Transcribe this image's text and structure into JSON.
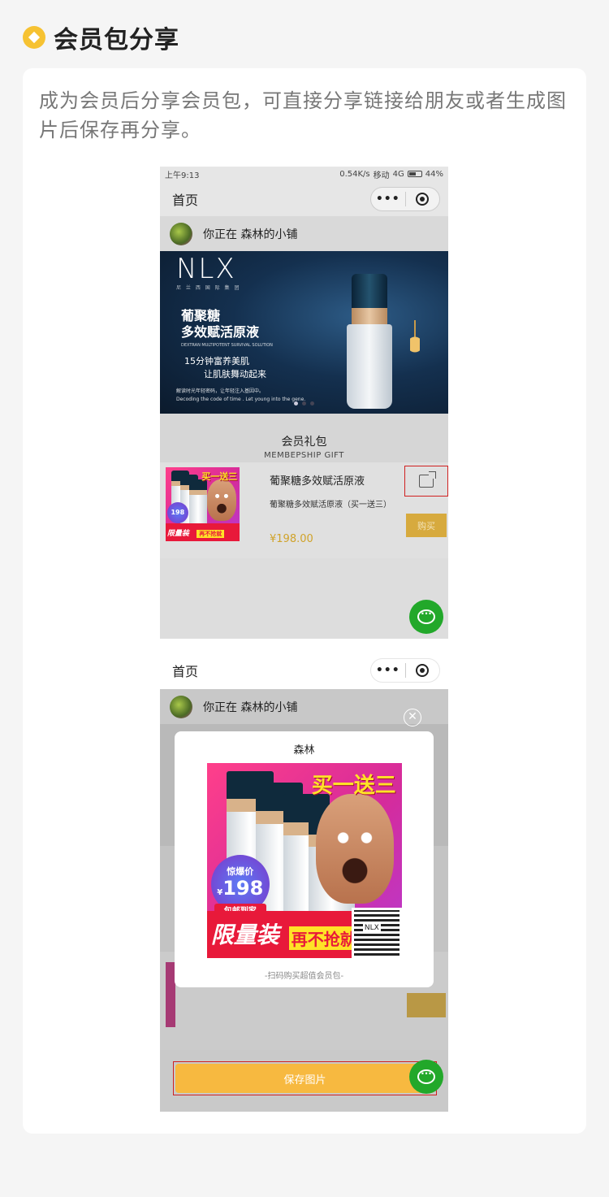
{
  "section": {
    "title": "会员包分享"
  },
  "description": "成为会员后分享会员包，可直接分享链接给朋友或者生成图片后保存再分享。",
  "phone1": {
    "status": {
      "time": "上午9:13",
      "speed": "0.54K/s",
      "carrier": "移动",
      "network": "4G",
      "battery": "44%"
    },
    "nav_title": "首页",
    "store_text": "你正在 森林的小铺",
    "banner": {
      "brand": "NLX",
      "brand_sub": "尼 兰 西 国 际 集 团",
      "line1": "葡聚糖",
      "line2": "多效赋活原液",
      "line3": "DEXTRAN MULTIPOTENT SURVIVAL SOLUTION",
      "line4": "15分钟富养美肌",
      "line5": "让肌肤舞动起来",
      "line6": "解读时光年轻密码，让年轻注入基因中。",
      "line7": "Decoding the code of time . Let young into the gene."
    },
    "gift_cn": "会员礼包",
    "gift_en": "MEMBEPSHIP GIFT",
    "product": {
      "name": "葡聚糖多效赋活原液",
      "subtitle": "葡聚糖多效赋活原液（买一送三）",
      "price": "¥198.00",
      "buy_label": "购买"
    }
  },
  "phone2": {
    "nav_title": "首页",
    "store_text": "你正在 森林的小铺",
    "poster_title": "森林",
    "poster_footer": "-扫码购买超值会员包-",
    "save_label": "保存图片"
  },
  "promo": {
    "headline": "买一送三",
    "badge_top": "惊爆价",
    "badge_price": "198",
    "badge_currency": "¥",
    "badge_bottom": "包邮到家",
    "bar_left": "限量装",
    "bar_right": "再不抢就",
    "qr_brand": "NLX"
  },
  "icons": [
    "diamond-icon",
    "dots-icon",
    "target-icon",
    "share-icon",
    "chat-icon",
    "close-icon"
  ],
  "colors": {
    "accent": "#f6c232",
    "buy": "#d7aa3e",
    "save": "#f7b940",
    "chat": "#22a82a",
    "highlight": "#d02020"
  }
}
